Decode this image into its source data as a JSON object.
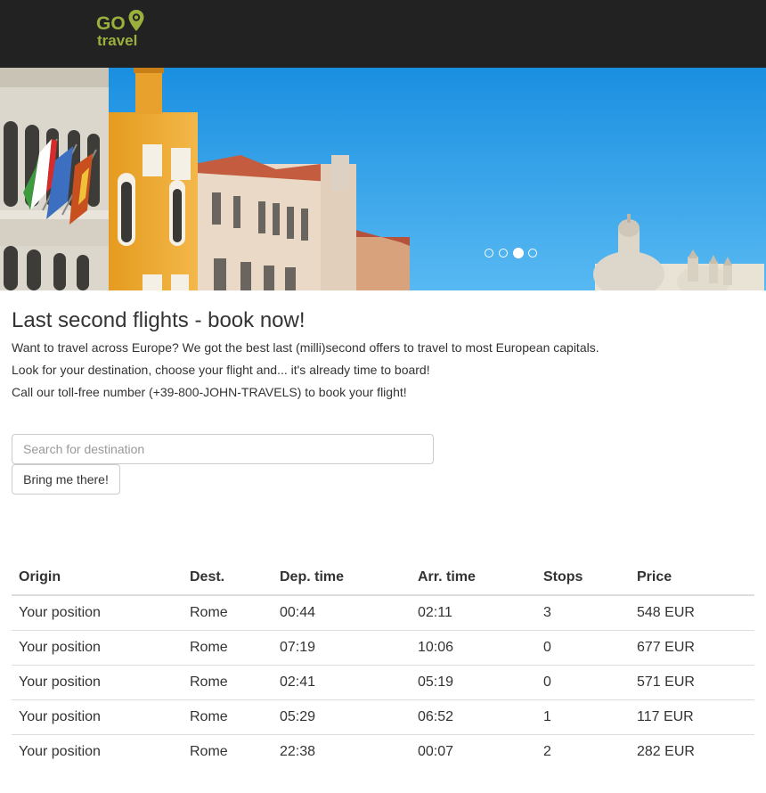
{
  "header": {
    "logo_top": "GO",
    "logo_bottom": "travel",
    "logo_color": "#9ab03c",
    "background": "#222222"
  },
  "hero": {
    "description_icon": "venice-photo",
    "carousel": {
      "total": 4,
      "active_index": 2
    }
  },
  "main": {
    "title": "Last second flights - book now!",
    "intro_line_1": "Want to travel across Europe? We got the best last (milli)second offers to travel to most European capitals.",
    "intro_line_2": "Look for your destination, choose your flight and... it's already time to board!",
    "intro_line_3": "Call our toll-free number (+39-800-JOHN-TRAVELS) to book your flight!"
  },
  "search": {
    "placeholder": "Search for destination",
    "value": "",
    "button_label": "Bring me there!"
  },
  "table": {
    "headers": [
      "Origin",
      "Dest.",
      "Dep. time",
      "Arr. time",
      "Stops",
      "Price"
    ],
    "rows": [
      [
        "Your position",
        "Rome",
        "00:44",
        "02:11",
        "3",
        "548 EUR"
      ],
      [
        "Your position",
        "Rome",
        "07:19",
        "10:06",
        "0",
        "677 EUR"
      ],
      [
        "Your position",
        "Rome",
        "02:41",
        "05:19",
        "0",
        "571 EUR"
      ],
      [
        "Your position",
        "Rome",
        "05:29",
        "06:52",
        "1",
        "117 EUR"
      ],
      [
        "Your position",
        "Rome",
        "22:38",
        "00:07",
        "2",
        "282 EUR"
      ]
    ]
  }
}
